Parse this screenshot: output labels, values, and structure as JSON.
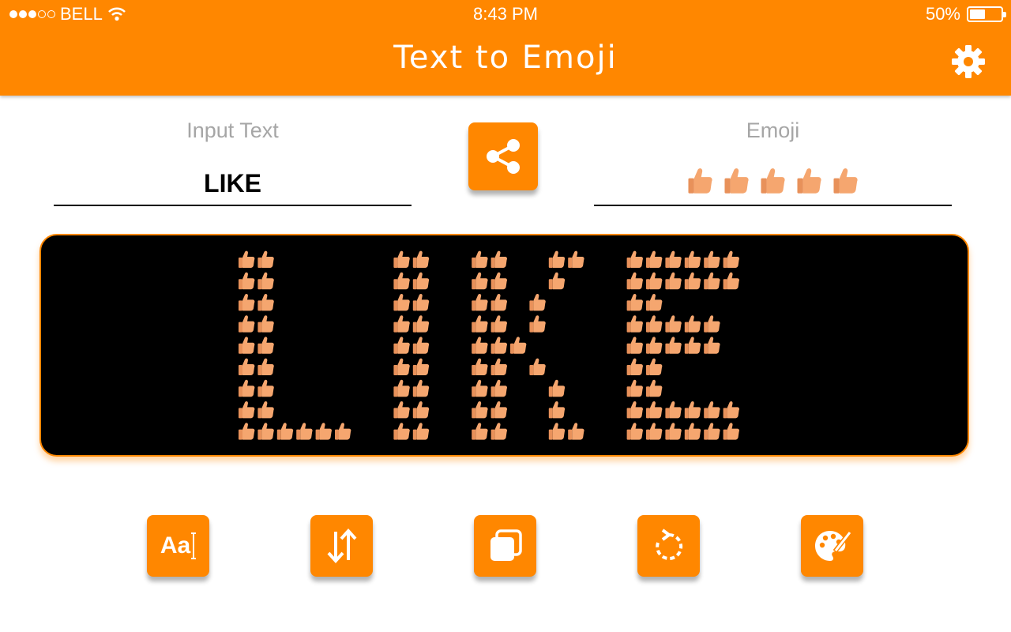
{
  "status_bar": {
    "carrier": "BELL",
    "time": "8:43 PM",
    "battery_percent": "50%",
    "battery_level": 0.5,
    "signal_bars_filled": 3,
    "signal_bars_total": 5
  },
  "nav": {
    "title": "Text to Emoji",
    "settings_icon": "gear-icon"
  },
  "input": {
    "label": "Input Text",
    "value": "LIKE"
  },
  "emoji": {
    "label": "Emoji",
    "symbol": "👍",
    "repeat": 5
  },
  "share": {
    "icon": "share-icon"
  },
  "display": {
    "text": "LIKE",
    "symbol": "👍",
    "background": "#000000",
    "border_color": "#ff8700"
  },
  "tools": [
    {
      "name": "font-button",
      "icon": "font-icon",
      "label": "Aa"
    },
    {
      "name": "orientation-button",
      "icon": "swap-vertical-icon"
    },
    {
      "name": "copy-button",
      "icon": "copy-icon"
    },
    {
      "name": "rotate-button",
      "icon": "rotate-icon"
    },
    {
      "name": "color-button",
      "icon": "palette-icon"
    }
  ],
  "colors": {
    "accent": "#ff8700",
    "label_gray": "#a6a6a6",
    "emoji_skin": "#f5a66f"
  }
}
